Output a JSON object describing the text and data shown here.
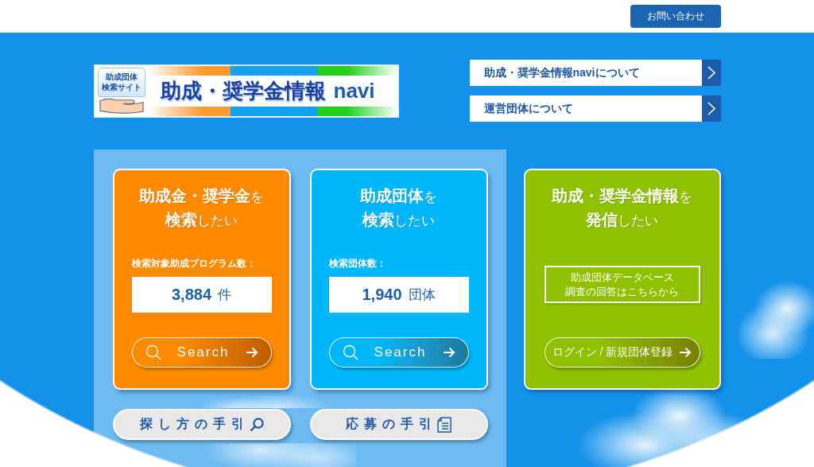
{
  "header": {
    "contact_button": "お問い合わせ"
  },
  "logo": {
    "badge": [
      "助成団体",
      "検索サイト"
    ],
    "title": "助成・奨学金情報",
    "suffix": "navi"
  },
  "nav_links": [
    {
      "label": "助成・奨学金情報naviについて"
    },
    {
      "label": "運営団体について"
    }
  ],
  "cards": [
    {
      "kind": "search",
      "color": "#ff8a00",
      "title": [
        "**助成金・奨学金**を",
        "**検索**したい"
      ],
      "count_label": "検索対象助成プログラム数：",
      "count": "3,884",
      "unit": "件",
      "button": "Search"
    },
    {
      "kind": "search",
      "color": "#00b7fb",
      "title": [
        "**助成団体**を",
        "**検索**したい"
      ],
      "count_label": "検索団体数：",
      "count": "1,940",
      "unit": "団体",
      "button": "Search"
    },
    {
      "kind": "publish",
      "color": "#90c100",
      "title": [
        "**助成・奨学金情報**を",
        "**発信**したい"
      ],
      "notice_button": [
        "助成団体データベース",
        "調査の回答はこちらから"
      ],
      "button": "ログイン / 新規団体登録"
    }
  ],
  "guides": [
    {
      "kind": "search",
      "label": "探し方の手引"
    },
    {
      "kind": "document",
      "label": "応募の手引"
    }
  ]
}
